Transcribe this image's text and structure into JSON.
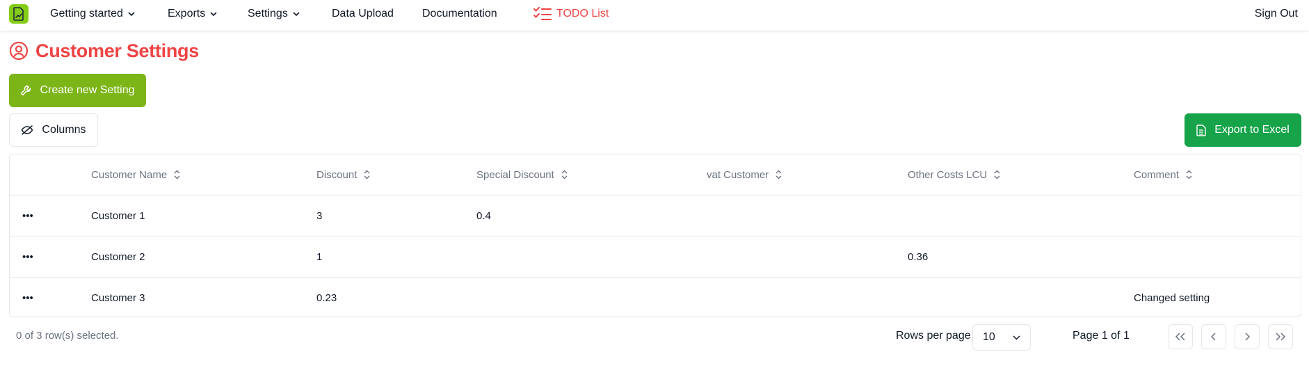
{
  "nav": {
    "items": [
      {
        "label": "Getting started",
        "dropdown": true
      },
      {
        "label": "Exports",
        "dropdown": true
      },
      {
        "label": "Settings",
        "dropdown": true
      },
      {
        "label": "Data Upload",
        "dropdown": false
      },
      {
        "label": "Documentation",
        "dropdown": false
      }
    ],
    "todo_label": "TODO List",
    "signout_label": "Sign Out"
  },
  "page": {
    "title": "Customer Settings"
  },
  "toolbar": {
    "create_label": "Create new Setting",
    "columns_label": "Columns",
    "export_label": "Export to Excel"
  },
  "table": {
    "headers": [
      "Customer Name",
      "Discount",
      "Special Discount",
      "vat Customer",
      "Other Costs LCU",
      "Comment"
    ],
    "rows": [
      {
        "actions": "•••",
        "cells": [
          "Customer 1",
          "3",
          "0.4",
          "",
          "",
          ""
        ]
      },
      {
        "actions": "•••",
        "cells": [
          "Customer 2",
          "1",
          "",
          "",
          "0.36",
          ""
        ]
      },
      {
        "actions": "•••",
        "cells": [
          "Customer 3",
          "0.23",
          "",
          "",
          "",
          "Changed setting"
        ]
      }
    ]
  },
  "footer": {
    "selected_text": "0 of 3 row(s) selected.",
    "rows_per_page_label": "Rows per page",
    "rows_per_page_value": "10",
    "page_info": "Page 1 of 1"
  },
  "colors": {
    "brand_green": "#84cc16",
    "create_button": "#7cb518",
    "export_button": "#16a34a",
    "accent_red": "#ef4444"
  },
  "icons": {
    "logo": "chart-file-icon",
    "todo": "list-checks-icon",
    "title": "user-circle-icon",
    "create": "wrench-icon",
    "columns": "eye-off-icon",
    "export": "file-spreadsheet-icon"
  }
}
